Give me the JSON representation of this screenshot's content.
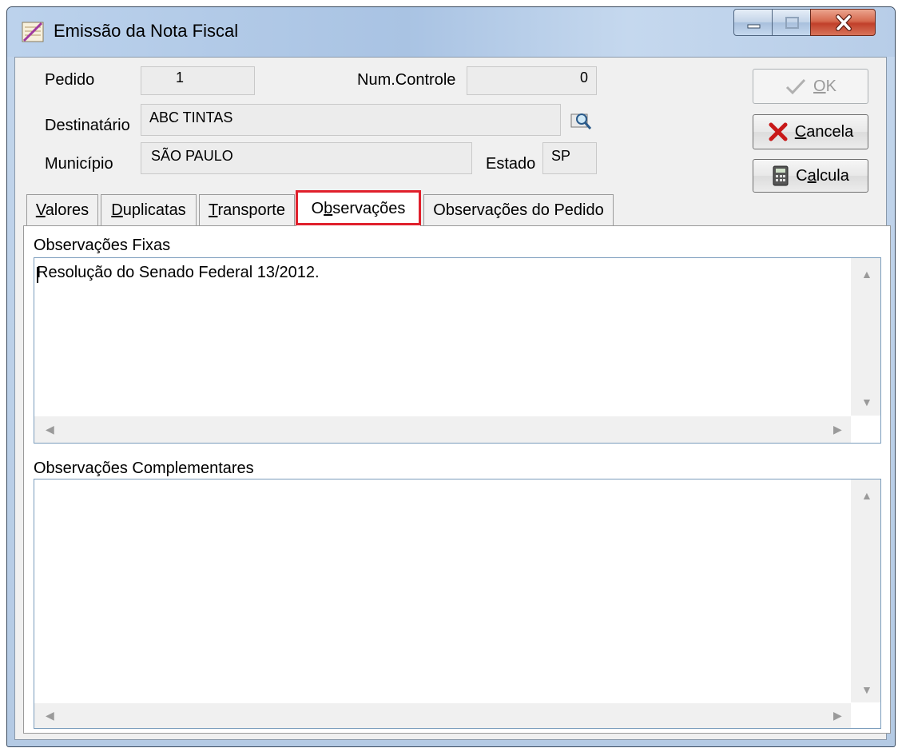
{
  "window": {
    "title": "Emissão da Nota Fiscal",
    "icon": "document-icon"
  },
  "header": {
    "pedido_label": "Pedido",
    "pedido_value": "1",
    "num_controle_label": "Num.Controle",
    "num_controle_value": "0",
    "destinatario_label": "Destinatário",
    "destinatario_value": "ABC TINTAS",
    "municipio_label": "Município",
    "municipio_value": "SÃO PAULO",
    "estado_label": "Estado",
    "estado_value": "SP"
  },
  "buttons": {
    "ok": {
      "key": "O",
      "rest": "K"
    },
    "cancela": {
      "key": "C",
      "rest": "ancela"
    },
    "calcula": {
      "pre": "C",
      "key": "a",
      "rest": "lcula"
    }
  },
  "tabs": [
    {
      "key": "V",
      "rest": "alores"
    },
    {
      "key": "D",
      "rest": "uplicatas"
    },
    {
      "key": "T",
      "rest": "ransporte"
    },
    {
      "pre": "O",
      "key": "b",
      "rest": "servações"
    },
    {
      "label": "Observações do Pedido"
    }
  ],
  "active_tab_index": 3,
  "observacoes": {
    "fixas_label": "Observações Fixas",
    "fixas_text": "Resolução do Senado Federal 13/2012.",
    "complementares_label": "Observações Complementares",
    "complementares_text": ""
  },
  "colors": {
    "highlight": "#e0202c",
    "cancel_x": "#c81818"
  }
}
